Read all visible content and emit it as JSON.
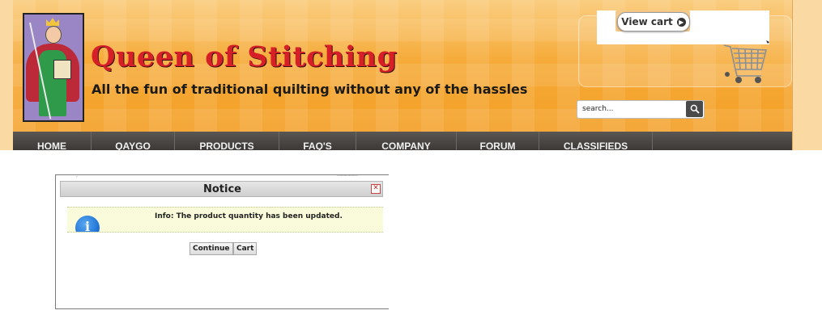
{
  "header": {
    "site_title": "Queen of Stitching",
    "tagline": "All the fun of traditional quilting without any of the hassles",
    "view_cart_label": "View cart",
    "search": {
      "placeholder": "search...",
      "value": ""
    }
  },
  "nav": {
    "items": [
      {
        "label": "HOME"
      },
      {
        "label": "QAYGO"
      },
      {
        "label": "PRODUCTS"
      },
      {
        "label": "FAQ'S"
      },
      {
        "label": "COMPANY"
      },
      {
        "label": "FORUM"
      },
      {
        "label": "CLASSIFIEDS"
      }
    ]
  },
  "dialog": {
    "title": "Notice",
    "close_glyph": "✕",
    "info_icon_glyph": "i",
    "message": "Info: The product quantity has been updated.",
    "buttons": {
      "continue_label": "Continue",
      "cart_label": "Cart"
    }
  },
  "colors": {
    "banner_orange": "#f4a32a",
    "title_red": "#d61f26",
    "nav_dark": "#3c3937",
    "info_bg": "#fafbda"
  },
  "icons": {
    "logo": "queen-illustration",
    "cart": "shopping-cart-icon",
    "search": "magnifier-icon",
    "info": "info-icon",
    "close": "close-icon",
    "view_cart_arrow": "arrow-right-circle-icon"
  }
}
